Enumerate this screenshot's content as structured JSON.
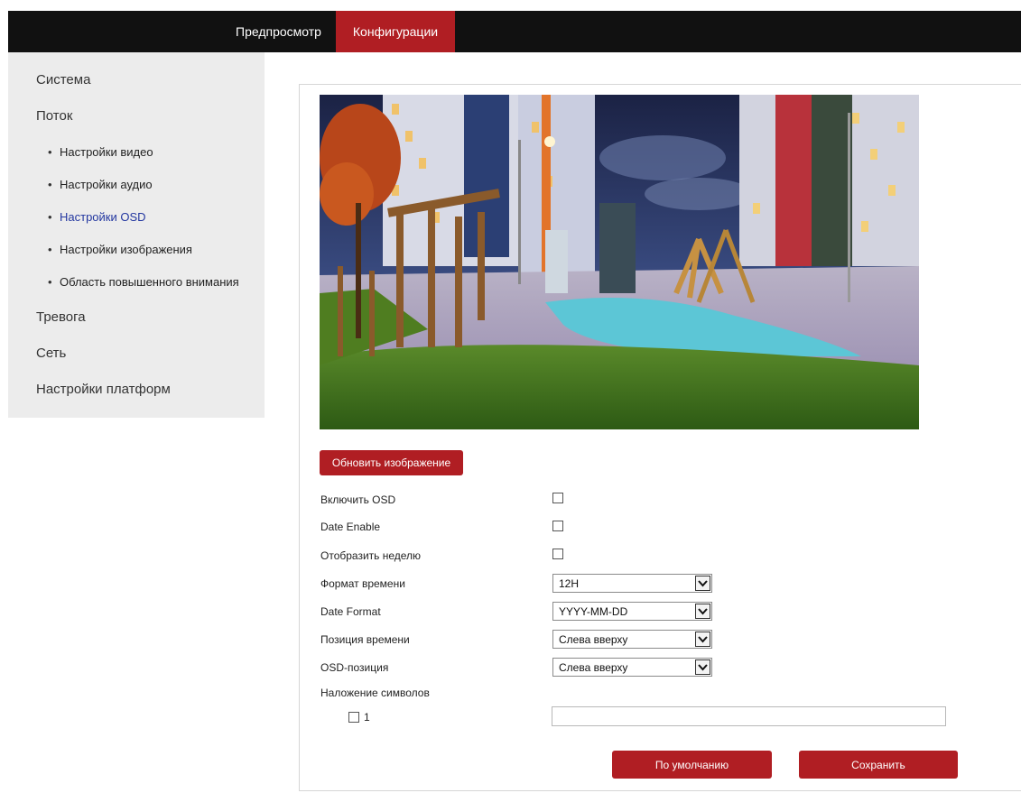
{
  "nav": {
    "preview_tab": "Предпросмотр",
    "config_tab": "Конфигурации"
  },
  "sidebar": {
    "items": [
      {
        "label": "Система"
      },
      {
        "label": "Поток"
      },
      {
        "label": "Настройки видео"
      },
      {
        "label": "Настройки аудио"
      },
      {
        "label": "Настройки OSD"
      },
      {
        "label": "Настройки изображения"
      },
      {
        "label": "Область повышенного внимания"
      },
      {
        "label": "Тревога"
      },
      {
        "label": "Сеть"
      },
      {
        "label": "Настройки платформ"
      }
    ]
  },
  "osd": {
    "refresh_button": "Обновить изображение",
    "enable_osd_label": "Включить OSD",
    "date_enable_label": "Date Enable",
    "show_week_label": "Отобразить неделю",
    "time_format_label": "Формат времени",
    "time_format_value": "12H",
    "date_format_label": "Date Format",
    "date_format_value": "YYYY-MM-DD",
    "time_position_label": "Позиция времени",
    "time_position_value": "Слева вверху",
    "osd_position_label": "OSD-позиция",
    "osd_position_value": "Слева вверху",
    "overlay_label": "Наложение символов",
    "overlay_row_number": "1",
    "overlay_text_value": "",
    "default_button": "По умолчанию",
    "save_button": "Сохранить"
  },
  "colors": {
    "accent": "#b01e23",
    "topbar": "#111111",
    "sidebar_bg": "#ececec",
    "active_link": "#2337a0"
  }
}
